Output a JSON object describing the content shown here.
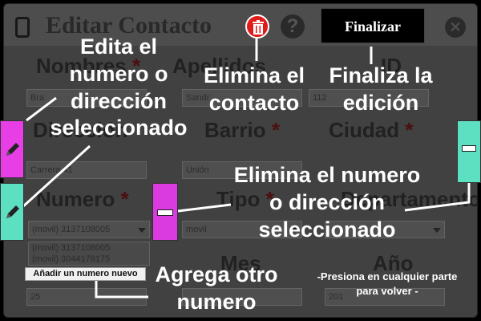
{
  "form": {
    "title": "Editar Contacto",
    "fields": {
      "nombres": {
        "label": "Nombres",
        "required": "*",
        "value": "Bra"
      },
      "apellidos": {
        "label": "Apellidos",
        "value": "Sandr"
      },
      "id": {
        "label": "ID",
        "value": "112"
      },
      "direccion": {
        "label": "Dirección",
        "value": "Carrera 41"
      },
      "barrio": {
        "label": "Barrio",
        "required": "*",
        "value": "Unión"
      },
      "ciudad": {
        "label": "Ciudad",
        "required": "*",
        "value": ""
      },
      "numero": {
        "label": "Numero",
        "required": "*",
        "value": "(movil) 3137108005"
      },
      "tipo": {
        "label": "Tipo",
        "required": "*",
        "value": "movil"
      },
      "departamento": {
        "label": "Departamento",
        "value": ""
      },
      "mes": {
        "label": "Mes",
        "value": ""
      },
      "anio": {
        "label": "Año",
        "value": "201"
      },
      "dia": {
        "value": "25"
      }
    },
    "phone_list": [
      "(movil) 3137108005",
      "(movil) 3044178175"
    ]
  },
  "overlay": {
    "finalize_button": "Finalizar",
    "add_number_button": "Añadir un numero nuevo",
    "callout_edit": "Edita el\nnumero o\ndirección\nseleccionado",
    "callout_delete_contact": "Elimina el\ncontacto",
    "callout_finalize": "Finaliza la\nedición",
    "callout_remove": "Elimina el numero\no dirección\nseleccionado",
    "callout_add": "Agrega otro\nnumero",
    "callout_dismiss": "-Presiona en cualquier parte\npara volver -"
  },
  "colors": {
    "edit_address_btn": "#e83ee6",
    "edit_number_btn": "#5de0c2",
    "remove_number_btn": "#d93be0",
    "remove_address_btn": "#5de0c2",
    "delete_contact_btn": "#e11a1a"
  },
  "icons": {
    "edit": "pencil-icon",
    "delete_contact": "trash-icon",
    "remove": "minus-icon",
    "help": "question-icon",
    "close": "close-icon",
    "app": "phone-icon"
  }
}
